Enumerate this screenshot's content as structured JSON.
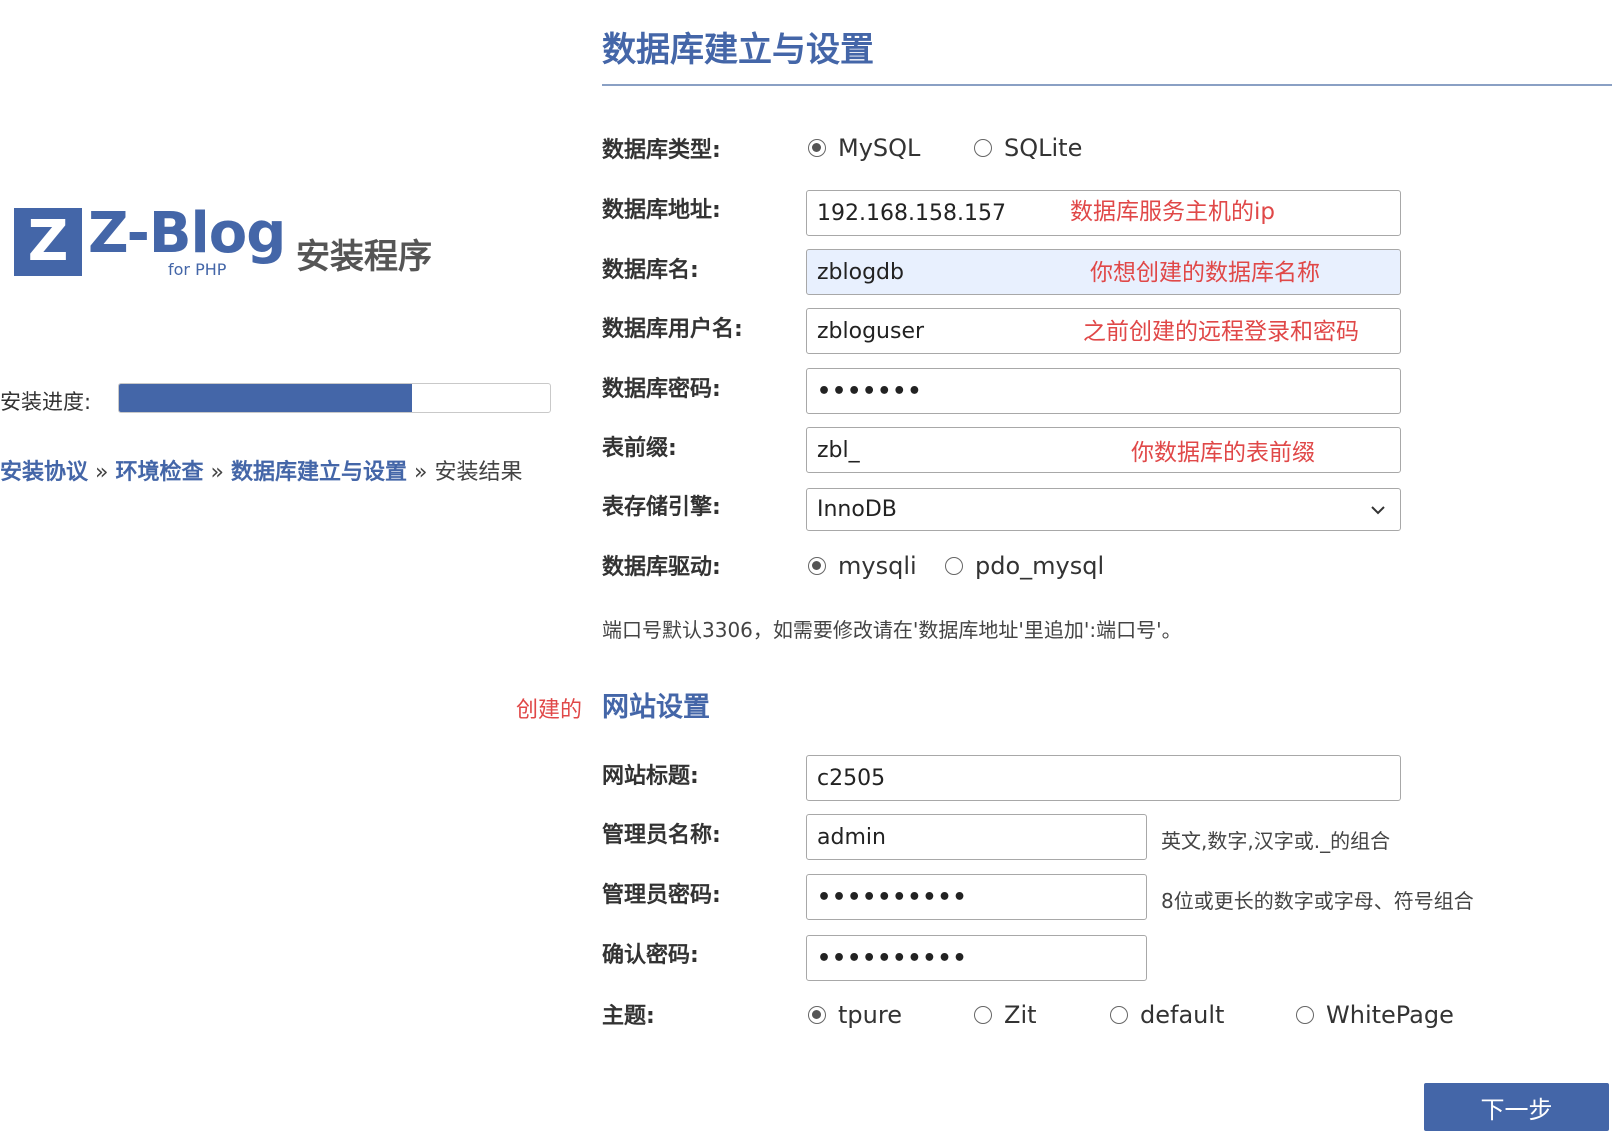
{
  "brand": {
    "logo_letter": "Z",
    "logo_word": "Z-Blog",
    "logo_sub": "for PHP",
    "setup_title": "安装程序"
  },
  "progress": {
    "label": "安装进度:",
    "fraction": 0.68
  },
  "breadcrumb": {
    "steps": [
      "安装协议",
      "环境检查",
      "数据库建立与设置",
      "安装结果"
    ],
    "separator": "»"
  },
  "side_note": "创建的",
  "main": {
    "title": "数据库建立与设置",
    "db": {
      "type_label": "数据库类型:",
      "type_options": [
        "MySQL",
        "SQLite"
      ],
      "type_selected": "MySQL",
      "host_label": "数据库地址:",
      "host_value": "192.168.158.157",
      "host_annotation": "数据库服务主机的ip",
      "name_label": "数据库名:",
      "name_value": "zblogdb",
      "name_annotation": "你想创建的数据库名称",
      "user_label": "数据库用户名:",
      "user_value": "zbloguser",
      "user_annotation": "之前创建的远程登录和密码",
      "password_label": "数据库密码:",
      "password_value": "•••••••",
      "prefix_label": "表前缀:",
      "prefix_value": "zbl_",
      "prefix_annotation": "你数据库的表前缀",
      "engine_label": "表存储引擎:",
      "engine_value": "InnoDB",
      "driver_label": "数据库驱动:",
      "driver_options": [
        "mysqli",
        "pdo_mysql"
      ],
      "driver_selected": "mysqli",
      "port_note": "端口号默认3306，如需要修改请在'数据库地址'里追加':端口号'。"
    },
    "site": {
      "title": "网站设置",
      "site_title_label": "网站标题:",
      "site_title_value": "c2505",
      "admin_name_label": "管理员名称:",
      "admin_name_value": "admin",
      "admin_name_hint": "英文,数字,汉字或._的组合",
      "admin_password_label": "管理员密码:",
      "admin_password_value": "••••••••••",
      "admin_password_hint": "8位或更长的数字或字母、符号组合",
      "confirm_password_label": "确认密码:",
      "confirm_password_value": "••••••••••",
      "theme_label": "主题:",
      "theme_options": [
        "tpure",
        "Zit",
        "default",
        "WhitePage"
      ],
      "theme_selected": "tpure"
    },
    "next_button": "下一步"
  },
  "colors": {
    "accent": "#4466a8",
    "annotation": "#e04848",
    "highlight_field": "#e8f0fe",
    "rule": "#8aa0c4"
  },
  "icons": [
    "z-logo-icon",
    "chevron-down-icon"
  ]
}
